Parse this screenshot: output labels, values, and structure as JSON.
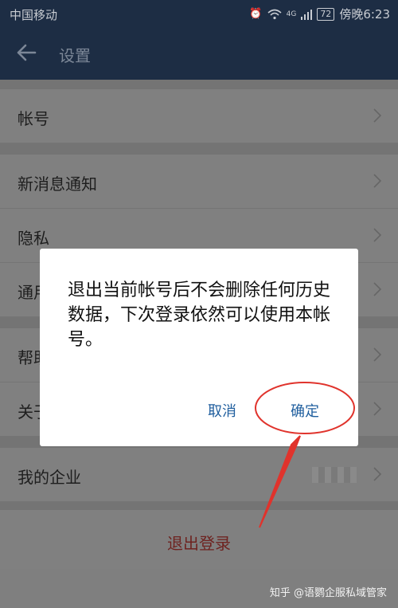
{
  "status_bar": {
    "carrier": "中国移动",
    "signal_label": "4G",
    "battery": "72",
    "time": "傍晚6:23"
  },
  "app_bar": {
    "title": "设置"
  },
  "settings": {
    "items": [
      {
        "label": "帐号"
      },
      {
        "label": "新消息通知"
      },
      {
        "label": "隐私"
      },
      {
        "label": "通用"
      },
      {
        "label": "帮助"
      },
      {
        "label": "关于"
      },
      {
        "label": "我的企业"
      }
    ],
    "logout": "退出登录"
  },
  "dialog": {
    "message": "退出当前帐号后不会删除任何历史数据，下次登录依然可以使用本帐号。",
    "cancel": "取消",
    "confirm": "确定"
  },
  "annotation": {
    "color": "#e0332c"
  },
  "watermark": "知乎 @语鹦企服私域管家"
}
